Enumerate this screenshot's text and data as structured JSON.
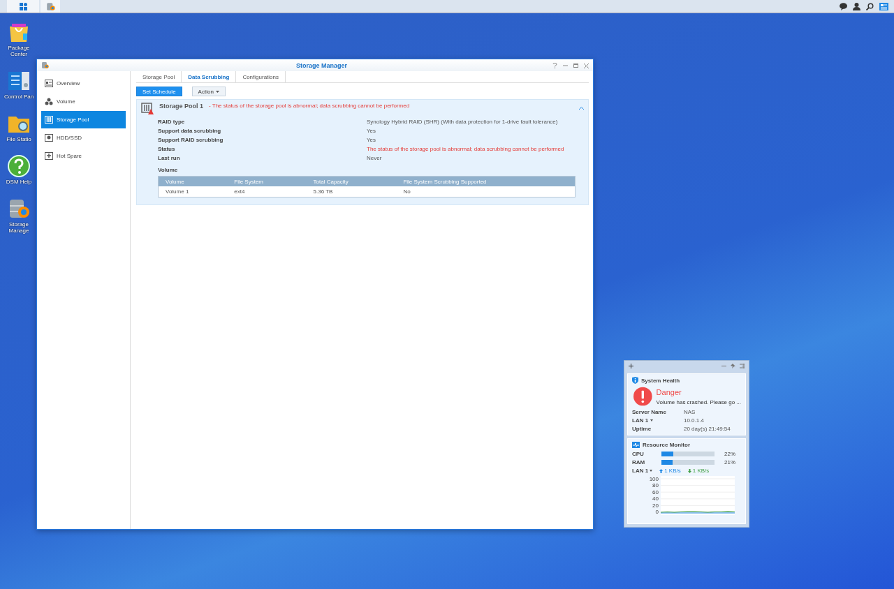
{
  "desktop_icons": [
    {
      "kind": "package",
      "label": "Package Center"
    },
    {
      "kind": "control",
      "label": "Control Pan"
    },
    {
      "kind": "folder",
      "label": "File Statio"
    },
    {
      "kind": "help",
      "label": "DSM Help"
    },
    {
      "kind": "storage",
      "label": "Storage Manage"
    }
  ],
  "window": {
    "title": "Storage Manager",
    "sidebar": [
      {
        "kind": "overview",
        "label": "Overview",
        "selected": false
      },
      {
        "kind": "volume",
        "label": "Volume",
        "selected": false
      },
      {
        "kind": "pool",
        "label": "Storage Pool",
        "selected": true
      },
      {
        "kind": "disk",
        "label": "HDD/SSD",
        "selected": false
      },
      {
        "kind": "spare",
        "label": "Hot Spare",
        "selected": false
      }
    ],
    "tabs": [
      {
        "label": "Storage Pool",
        "selected": false
      },
      {
        "label": "Data Scrubbing",
        "selected": true
      },
      {
        "label": "Configurations",
        "selected": false
      }
    ],
    "toolbar": [
      {
        "kind": "primary",
        "label": "Set Schedule"
      },
      {
        "kind": "menu",
        "label": "Action"
      }
    ],
    "pool": {
      "name": "Storage Pool 1",
      "warning": "- The status of the storage pool is abnormal; data scrubbing cannot be performed",
      "expanded": true,
      "properties": [
        {
          "label": "RAID type",
          "value": "Synology Hybrid RAID (SHR) (With data protection for 1-drive fault tolerance)",
          "kind": "normal"
        },
        {
          "label": "Support data scrubbing",
          "value": "Yes",
          "kind": "normal"
        },
        {
          "label": "Support RAID scrubbing",
          "value": "Yes",
          "kind": "normal"
        },
        {
          "label": "Status",
          "value": "The status of the storage pool is abnormal; data scrubbing cannot be performed",
          "kind": "error"
        },
        {
          "label": "Last run",
          "value": "Never",
          "kind": "normal"
        }
      ],
      "volume_heading": "Volume",
      "table": {
        "columns": [
          "Volume",
          "File System",
          "Total Capacity",
          "File System Scrubbing Supported"
        ],
        "rows": [
          [
            "Volume 1",
            "ext4",
            "5.36 TB",
            "No"
          ]
        ]
      }
    }
  },
  "widget": {
    "health": {
      "title": "System Health",
      "status": "Danger",
      "message": "Volume has crashed. Please go ...",
      "rows": [
        {
          "label": "Server Name",
          "value": "NAS",
          "dropdown": false
        },
        {
          "label": "LAN 1",
          "value": "10.0.1.4",
          "dropdown": true
        },
        {
          "label": "Uptime",
          "value": "20 day(s) 21:49:54",
          "dropdown": false
        }
      ]
    },
    "monitor": {
      "title": "Resource Monitor",
      "meters": [
        {
          "label": "CPU",
          "level": 0.22,
          "reading": "22%"
        },
        {
          "label": "RAM",
          "level": 0.21,
          "reading": "21%"
        }
      ],
      "lan": {
        "label": "LAN 1",
        "upload": "1 KB/s",
        "download": "1 KB/s"
      },
      "chart_data": {
        "type": "line",
        "ylim": [
          0,
          100
        ],
        "yticks": [
          0,
          20,
          40,
          60,
          80,
          100
        ],
        "grid": true,
        "series": [
          {
            "color": "#43a047",
            "values": [
              0,
              1,
              0,
              1,
              2,
              2,
              1,
              0,
              1,
              1,
              2,
              1
            ]
          }
        ]
      }
    }
  }
}
